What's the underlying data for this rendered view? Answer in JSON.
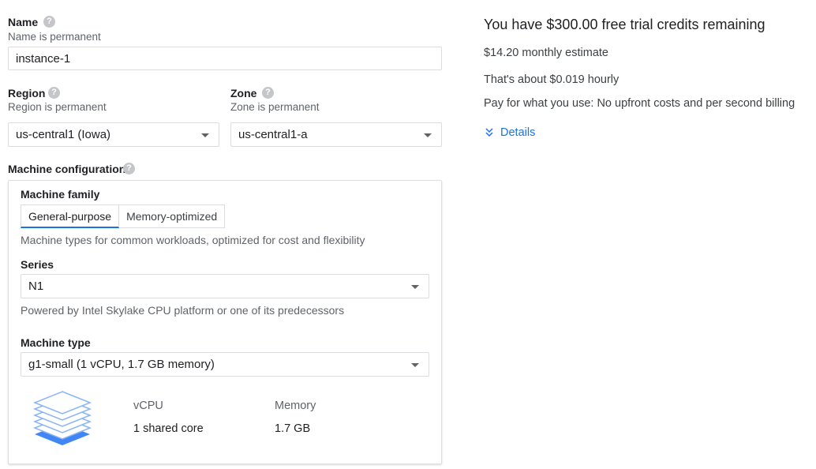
{
  "name_section": {
    "label": "Name",
    "help": "?",
    "sublabel": "Name is permanent",
    "value": "instance-1"
  },
  "region_section": {
    "label": "Region",
    "help": "?",
    "sublabel": "Region is permanent",
    "value": "us-central1 (Iowa)"
  },
  "zone_section": {
    "label": "Zone",
    "help": "?",
    "sublabel": "Zone is permanent",
    "value": "us-central1-a"
  },
  "machine_configuration": {
    "label": "Machine configuration",
    "help": "?",
    "family_label": "Machine family",
    "tabs": [
      {
        "label": "General-purpose",
        "active": true
      },
      {
        "label": "Memory-optimized",
        "active": false
      }
    ],
    "family_description": "Machine types for common workloads, optimized for cost and flexibility",
    "series_label": "Series",
    "series_value": "N1",
    "series_description": "Powered by Intel Skylake CPU platform or one of its predecessors",
    "machine_type_label": "Machine type",
    "machine_type_value": "g1-small (1 vCPU, 1.7 GB memory)",
    "specs": {
      "vcpu_header": "vCPU",
      "vcpu_value": "1 shared core",
      "memory_header": "Memory",
      "memory_value": "1.7 GB"
    },
    "icon": "stacked-layers-icon"
  },
  "pricing": {
    "title": "You have $300.00 free trial credits remaining",
    "monthly": "$14.20 monthly estimate",
    "hourly": "That's about $0.019 hourly",
    "billing_note": "Pay for what you use: No upfront costs and per second billing",
    "details_label": "Details",
    "details_icon": "chevron-double-down-icon"
  },
  "colors": {
    "accent": "#1a73e8",
    "text": "#202124",
    "secondary_text": "#5f6368",
    "border": "#dadce0"
  }
}
